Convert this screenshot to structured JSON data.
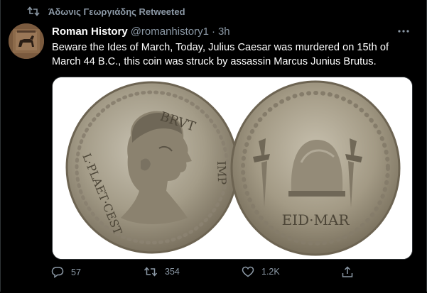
{
  "retweet_banner": {
    "text": "Άδωνις Γεωργιάδης Retweeted",
    "icon": "retweet-icon"
  },
  "tweet": {
    "author_name": "Roman History",
    "handle": "@romanhistory1",
    "separator": "·",
    "time": "3h",
    "more_icon": "more-icon",
    "text": "Beware the Ides of March, Today, Julius Caesar was murdered on 15th of March 44 B.C., this coin was struck by assassin Marcus Junius Brutus.",
    "coin_inscriptions": {
      "obverse_top": "BRVT",
      "obverse_left": "L·PLAET·CEST",
      "obverse_right": "IMP",
      "reverse_bottom": "EID·MAR"
    },
    "actions": [
      {
        "icon": "reply-icon",
        "count": "57"
      },
      {
        "icon": "retweet-icon",
        "count": "354"
      },
      {
        "icon": "like-icon",
        "count": "1.2K"
      },
      {
        "icon": "share-icon",
        "count": ""
      }
    ]
  },
  "colors": {
    "background": "#000000",
    "text_primary": "#ffffff",
    "text_secondary": "#8b98a5",
    "border": "#2f3336"
  }
}
